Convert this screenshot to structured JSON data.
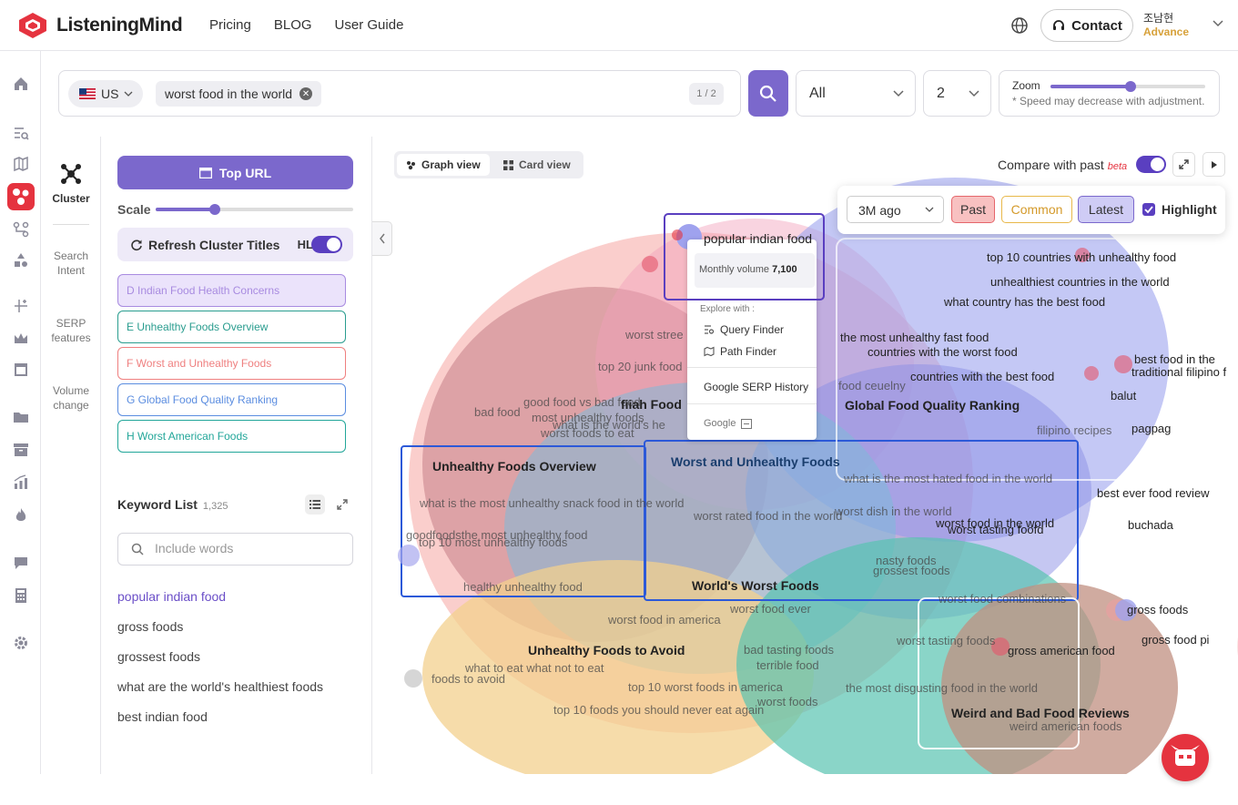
{
  "header": {
    "logo_text": "ListeningMind",
    "nav": [
      "Pricing",
      "BLOG",
      "User Guide"
    ],
    "contact_label": "Contact",
    "user_name": "조남현",
    "user_plan": "Advance"
  },
  "search": {
    "country": "US",
    "keyword_chip": "worst food in the world",
    "pager": "1 / 2",
    "filter_value": "All",
    "depth_value": "2",
    "zoom_label": "Zoom",
    "zoom_note": "* Speed may decrease with adjustment.",
    "zoom_level": 0.52
  },
  "tabs": {
    "cluster": "Cluster",
    "search_intent": "Search Intent",
    "serp_features": "SERP features",
    "volume_change": "Volume change"
  },
  "left_panel": {
    "top_url_label": "Top URL",
    "scale_label": "Scale",
    "scale_level": 0.3,
    "refresh_label": "Refresh Cluster Titles",
    "hl_label": "HL",
    "clusters": [
      {
        "label": "D Indian Food Health Concerns",
        "color": "#a88be0",
        "bg": "#ebe3fb"
      },
      {
        "label": "E Unhealthy Foods Overview",
        "color": "#2a9d8f",
        "bg": "#ffffff"
      },
      {
        "label": "F Worst and Unhealthy Foods",
        "color": "#ef7f7f",
        "bg": "#ffffff"
      },
      {
        "label": "G Global Food Quality Ranking",
        "color": "#5b8de0",
        "bg": "#ffffff"
      },
      {
        "label": "H Worst American Foods",
        "color": "#22a699",
        "bg": "#ffffff"
      }
    ],
    "keyword_list_title": "Keyword List",
    "keyword_count": "1,325",
    "include_placeholder": "Include words",
    "keywords": [
      "popular indian food",
      "gross foods",
      "grossest foods",
      "what are the world's healthiest foods",
      "best indian food"
    ]
  },
  "graph": {
    "views": [
      "Graph view",
      "Card view"
    ],
    "compare_label": "Compare with past",
    "beta_label": "beta",
    "ago_value": "3M ago",
    "past_label": "Past",
    "common_label": "Common",
    "latest_label": "Latest",
    "highlight_label": "Highlight",
    "tooltip": {
      "title": "popular indian food",
      "volume_label": "Monthly volume",
      "volume_value": "7,100",
      "explore_label": "Explore with :",
      "query_finder": "Query Finder",
      "path_finder": "Path Finder",
      "serp_history": "Google SERP History",
      "google_label": "Google"
    },
    "cluster_titles": [
      "Unhealthy Foods Overview",
      "Worst and Unhealthy Foods",
      "World's Worst Foods",
      "Global Food Quality Ranking",
      "Unhealthy Foods to Avoid",
      "Weird and Bad Food Reviews",
      "fiiah Food"
    ],
    "keywords": [
      "top 10 countries with unhealthy food",
      "unhealthiest countries in the world",
      "what country has the best food",
      "the most unhealthy fast food",
      "countries with the worst food",
      "countries with the best food",
      "food ceuelny",
      "best food in the",
      "traditional filipino f",
      "balut",
      "filipino recipes",
      "pagpag",
      "worst stree",
      "top 20 junk food",
      "good food vs bad food",
      "bad food",
      "most unhealthy foods",
      "what is the world's he",
      "worst foods to eat",
      "what is the most unhealthy snack food in the world",
      "worst rated food in the world",
      "what is the most hated food in the world",
      "worst dish in the world",
      "worst food in the world",
      "worst tasting foofd",
      "best ever food review",
      "buchada",
      "goodfoodsthe most unhealthy food",
      "top 10 most unhealthy foods",
      "nasty foods",
      "grossest foods",
      "healthy unhealthy food",
      "worst food combinations",
      "worst food ever",
      "worst food in america",
      "gross foods",
      "gross food pi",
      "worst tasting foods",
      "gross american food",
      "foods to avoid",
      "what to eat what not to eat",
      "bad tasting foods",
      "terrible food",
      "top 10 worst foods in america",
      "the most disgusting food in the world",
      "worst foods",
      "top 10 foods you should never eat again",
      "weird american foods"
    ]
  }
}
